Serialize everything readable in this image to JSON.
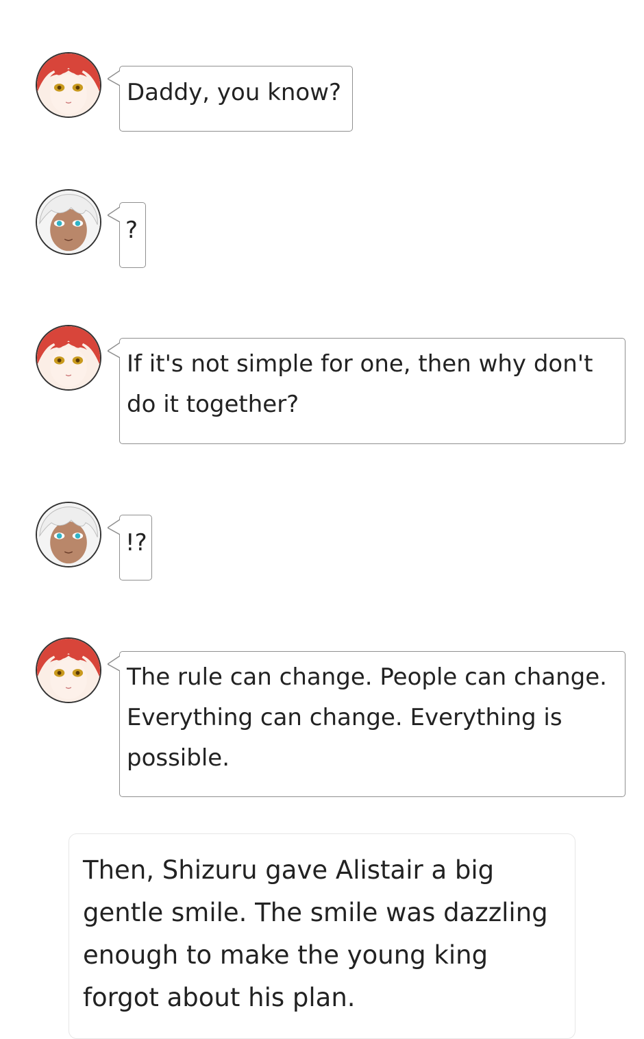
{
  "messages": [
    {
      "speaker": "shizuru",
      "text": "Daddy, you know?"
    },
    {
      "speaker": "alistair",
      "text": "?"
    },
    {
      "speaker": "shizuru",
      "text": "If it's not simple for one, then why don't do it together?"
    },
    {
      "speaker": "alistair",
      "text": "!?"
    },
    {
      "speaker": "shizuru",
      "text": "The rule can change. People can change. Everything can change. Everything is possible."
    }
  ],
  "narration": {
    "text": "Then, Shizuru gave Alistair a big gentle smile. The smile was dazzling enough to make the young king forgot about his plan."
  },
  "colors": {
    "bubble_border": "#8f8f8f",
    "text": "#222222",
    "shizuru_hair": "#d8453a",
    "alistair_hair": "#eeeeee",
    "alistair_skin": "#b9876a"
  }
}
